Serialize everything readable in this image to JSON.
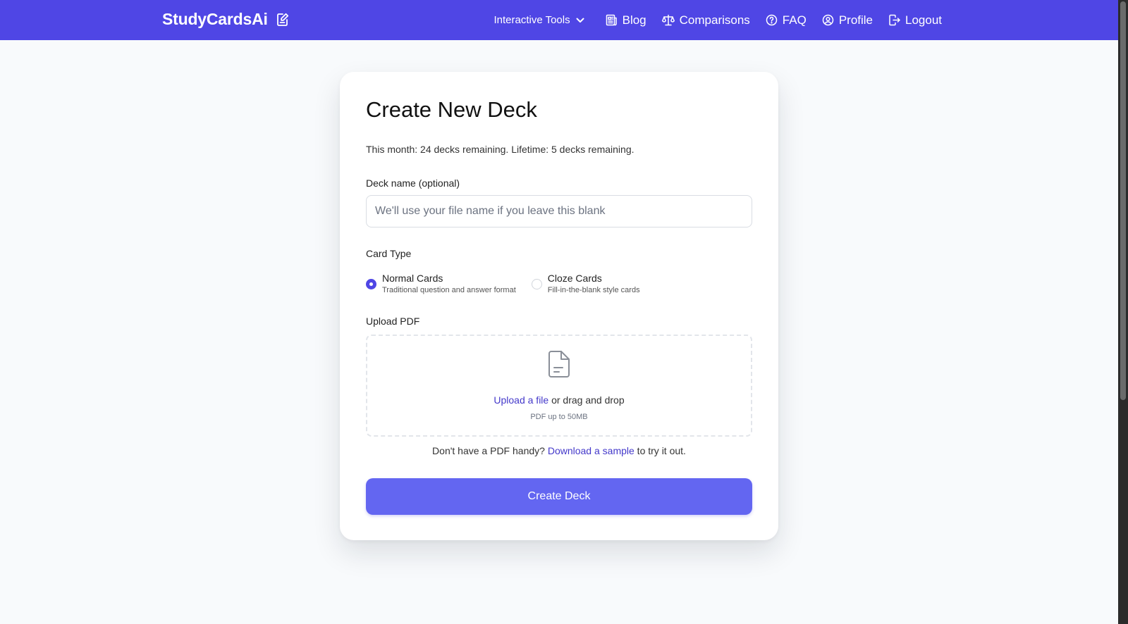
{
  "nav": {
    "brand": "StudyCardsAi",
    "tools_label": "Interactive Tools",
    "blog_label": "Blog",
    "comparisons_label": "Comparisons",
    "faq_label": "FAQ",
    "profile_label": "Profile",
    "logout_label": "Logout"
  },
  "form": {
    "title": "Create New Deck",
    "quota": "This month: 24 decks remaining. Lifetime: 5 decks remaining.",
    "deck_name_label": "Deck name (optional)",
    "deck_name_value": "",
    "deck_name_placeholder": "We'll use your file name if you leave this blank",
    "card_type_label": "Card Type",
    "card_types": [
      {
        "title": "Normal Cards",
        "desc": "Traditional question and answer format",
        "selected": true
      },
      {
        "title": "Cloze Cards",
        "desc": "Fill-in-the-blank style cards",
        "selected": false
      }
    ],
    "upload_label": "Upload PDF",
    "upload_link": "Upload a file",
    "upload_text": " or drag and drop",
    "upload_hint": "PDF up to 50MB",
    "sample_prefix": "Don't have a PDF handy? ",
    "sample_link": "Download a sample",
    "sample_suffix": " to try it out.",
    "submit_label": "Create Deck"
  },
  "colors": {
    "nav_bg": "#4f46e5",
    "accent": "#4f46e5",
    "button_bg": "#6366f1",
    "link": "#4338ca",
    "page_bg": "#f8fafc"
  },
  "icons": {
    "brand": "edit-square-icon",
    "tools": "chevron-down-icon",
    "blog": "newspaper-icon",
    "comparisons": "scale-icon",
    "faq": "question-circle-icon",
    "profile": "user-circle-icon",
    "logout": "logout-icon",
    "upload": "document-icon"
  }
}
